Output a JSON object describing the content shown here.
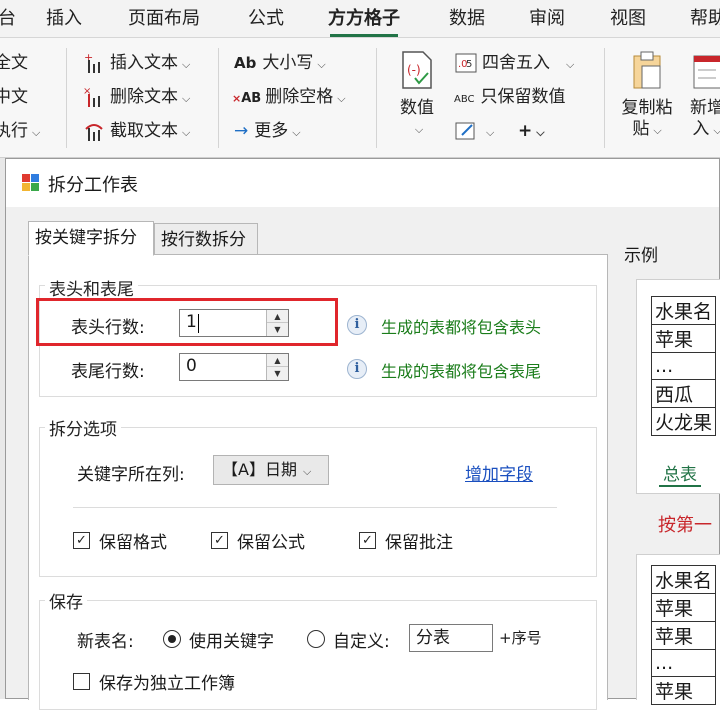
{
  "ribbon_tabs": [
    "台",
    "插入",
    "页面布局",
    "公式",
    "方方格子",
    "数据",
    "审阅",
    "视图",
    "帮助"
  ],
  "ribbon_left_fragments": [
    "全文",
    "中文",
    "执行"
  ],
  "ribbon_text_group": {
    "insert_text": "插入文本",
    "delete_text": "删除文本",
    "extract_text": "截取文本"
  },
  "ribbon_case_group": {
    "case_icon": "Ab",
    "case": "大小写",
    "delete_spaces_icon": "AB",
    "delete_spaces": "删除空格",
    "more": "更多"
  },
  "ribbon_number_group": {
    "value_label": "数值",
    "round_label": "四舍五入",
    "keep_values_icon": "ABC",
    "keep_values": "只保留数值"
  },
  "ribbon_right": {
    "copy_paste_line1": "复制粘",
    "copy_paste_line2": "贴",
    "add_new_line1": "新增",
    "add_new_line2": "入"
  },
  "dialog": {
    "title": "拆分工作表",
    "tabs": [
      "按关键字拆分",
      "按行数拆分"
    ],
    "header_footer": {
      "group_title": "表头和表尾",
      "header_rows_label": "表头行数:",
      "header_rows_value": "1",
      "header_hint": "生成的表都将包含表头",
      "footer_rows_label": "表尾行数:",
      "footer_rows_value": "0",
      "footer_hint": "生成的表都将包含表尾"
    },
    "split_options": {
      "group_title": "拆分选项",
      "key_column_label": "关键字所在列:",
      "key_column_value": "【A】日期",
      "add_field_link": "增加字段",
      "keep_format": "保留格式",
      "keep_formula": "保留公式",
      "keep_comment": "保留批注"
    },
    "save": {
      "group_title": "保存",
      "new_name_label": "新表名:",
      "use_keyword": "使用关键字",
      "custom": "自定义:",
      "custom_value": "分表",
      "suffix": "+序号",
      "save_as_workbook": "保存为独立工作簿"
    },
    "example": {
      "title": "示例",
      "table1": [
        "水果名",
        "苹果",
        "...",
        "西瓜",
        "火龙果"
      ],
      "sheet_tab": "总表",
      "caption": "按第一",
      "table2": [
        "水果名",
        "苹果",
        "苹果",
        "...",
        "苹果"
      ]
    }
  }
}
